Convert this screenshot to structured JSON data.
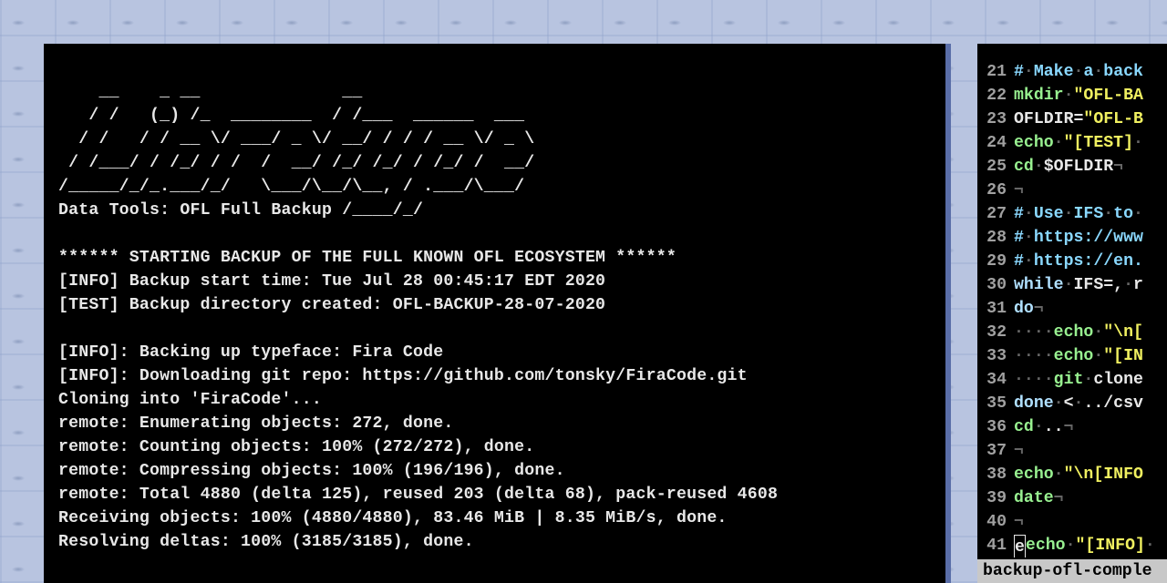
{
  "terminal": {
    "ascii_l1": "    __    _ __              __",
    "ascii_l2": "   / /   (_) /_  ________  / /___  ______  ___",
    "ascii_l3": "  / /   / / __ \\/ ___/ _ \\/ __/ / / / __ \\/ _ \\",
    "ascii_l4": " / /___/ / /_/ / /  /  __/ /_/ /_/ / /_/ /  __/",
    "ascii_l5": "/_____/_/_.___/_/   \\___/\\__/\\__, / .___/\\___/",
    "subtitle": "Data Tools: OFL Full Backup /____/_/",
    "line_start": "****** STARTING BACKUP OF THE FULL KNOWN OFL ECOSYSTEM ******",
    "line_info_start": "[INFO] Backup start time: Tue Jul 28 00:45:17 EDT 2020",
    "line_test_dir": "[TEST] Backup directory created: OFL-BACKUP-28-07-2020",
    "line_info_face": "[INFO]: Backing up typeface: Fira Code",
    "line_info_dl": "[INFO]: Downloading git repo: https://github.com/tonsky/FiraCode.git",
    "line_clone": "Cloning into 'FiraCode'...",
    "line_enum": "remote: Enumerating objects: 272, done.",
    "line_count": "remote: Counting objects: 100% (272/272), done.",
    "line_comp": "remote: Compressing objects: 100% (196/196), done.",
    "line_total": "remote: Total 4880 (delta 125), reused 203 (delta 68), pack-reused 4608",
    "line_recv": "Receiving objects: 100% (4880/4880), 83.46 MiB | 8.35 MiB/s, done.",
    "line_resv": "Resolving deltas: 100% (3185/3185), done."
  },
  "editor": {
    "status_filename": "backup-ofl-comple",
    "lines": [
      {
        "n": 21,
        "tokens": [
          [
            "com",
            "#"
          ],
          [
            "ws",
            "·"
          ],
          [
            "com",
            "Make"
          ],
          [
            "ws",
            "·"
          ],
          [
            "com",
            "a"
          ],
          [
            "ws",
            "·"
          ],
          [
            "com",
            "back"
          ]
        ]
      },
      {
        "n": 22,
        "tokens": [
          [
            "cmd",
            "mkdir"
          ],
          [
            "ws",
            "·"
          ],
          [
            "str",
            "\"OFL-BA"
          ]
        ]
      },
      {
        "n": 23,
        "tokens": [
          [
            "var",
            "OFLDIR"
          ],
          [
            "var",
            "="
          ],
          [
            "str",
            "\"OFL-B"
          ]
        ]
      },
      {
        "n": 24,
        "tokens": [
          [
            "cmd",
            "echo"
          ],
          [
            "ws",
            "·"
          ],
          [
            "str",
            "\"[TEST]"
          ],
          [
            "ws",
            "·"
          ]
        ]
      },
      {
        "n": 25,
        "tokens": [
          [
            "cmd",
            "cd"
          ],
          [
            "ws",
            "·"
          ],
          [
            "var",
            "$OFLDIR"
          ],
          [
            "ws",
            "¬"
          ]
        ]
      },
      {
        "n": 26,
        "tokens": [
          [
            "ws",
            "¬"
          ]
        ]
      },
      {
        "n": 27,
        "tokens": [
          [
            "com",
            "#"
          ],
          [
            "ws",
            "·"
          ],
          [
            "com",
            "Use"
          ],
          [
            "ws",
            "·"
          ],
          [
            "com",
            "IFS"
          ],
          [
            "ws",
            "·"
          ],
          [
            "com",
            "to"
          ],
          [
            "ws",
            "·"
          ]
        ]
      },
      {
        "n": 28,
        "tokens": [
          [
            "com",
            "#"
          ],
          [
            "ws",
            "·"
          ],
          [
            "com",
            "https://www"
          ]
        ]
      },
      {
        "n": 29,
        "tokens": [
          [
            "com",
            "#"
          ],
          [
            "ws",
            "·"
          ],
          [
            "com",
            "https://en."
          ]
        ]
      },
      {
        "n": 30,
        "tokens": [
          [
            "kw",
            "while"
          ],
          [
            "ws",
            "·"
          ],
          [
            "var",
            "IFS=,"
          ],
          [
            "ws",
            "·"
          ],
          [
            "var",
            "r"
          ]
        ]
      },
      {
        "n": 31,
        "tokens": [
          [
            "kw",
            "do"
          ],
          [
            "ws",
            "¬"
          ]
        ]
      },
      {
        "n": 32,
        "tokens": [
          [
            "ws",
            "····"
          ],
          [
            "cmd",
            "echo"
          ],
          [
            "ws",
            "·"
          ],
          [
            "str",
            "\"\\n["
          ]
        ]
      },
      {
        "n": 33,
        "tokens": [
          [
            "ws",
            "····"
          ],
          [
            "cmd",
            "echo"
          ],
          [
            "ws",
            "·"
          ],
          [
            "str",
            "\"[IN"
          ]
        ]
      },
      {
        "n": 34,
        "tokens": [
          [
            "ws",
            "····"
          ],
          [
            "cmd",
            "git"
          ],
          [
            "ws",
            "·"
          ],
          [
            "var",
            "clone"
          ]
        ]
      },
      {
        "n": 35,
        "tokens": [
          [
            "kw",
            "done"
          ],
          [
            "ws",
            "·"
          ],
          [
            "var",
            "<"
          ],
          [
            "ws",
            "·"
          ],
          [
            "var",
            "../csv"
          ]
        ]
      },
      {
        "n": 36,
        "tokens": [
          [
            "cmd",
            "cd"
          ],
          [
            "ws",
            "·"
          ],
          [
            "var",
            ".."
          ],
          [
            "ws",
            "¬"
          ]
        ]
      },
      {
        "n": 37,
        "tokens": [
          [
            "ws",
            "¬"
          ]
        ]
      },
      {
        "n": 38,
        "tokens": [
          [
            "cmd",
            "echo"
          ],
          [
            "ws",
            "·"
          ],
          [
            "str",
            "\"\\n[INFO"
          ]
        ]
      },
      {
        "n": 39,
        "tokens": [
          [
            "cmd",
            "date"
          ],
          [
            "ws",
            "¬"
          ]
        ]
      },
      {
        "n": 40,
        "tokens": [
          [
            "ws",
            "¬"
          ]
        ]
      },
      {
        "n": 41,
        "tokens": [
          [
            "cursor",
            ""
          ],
          [
            "cmd",
            "echo"
          ],
          [
            "ws",
            "·"
          ],
          [
            "str",
            "\"[INFO]"
          ],
          [
            "ws",
            "·"
          ]
        ]
      }
    ]
  }
}
